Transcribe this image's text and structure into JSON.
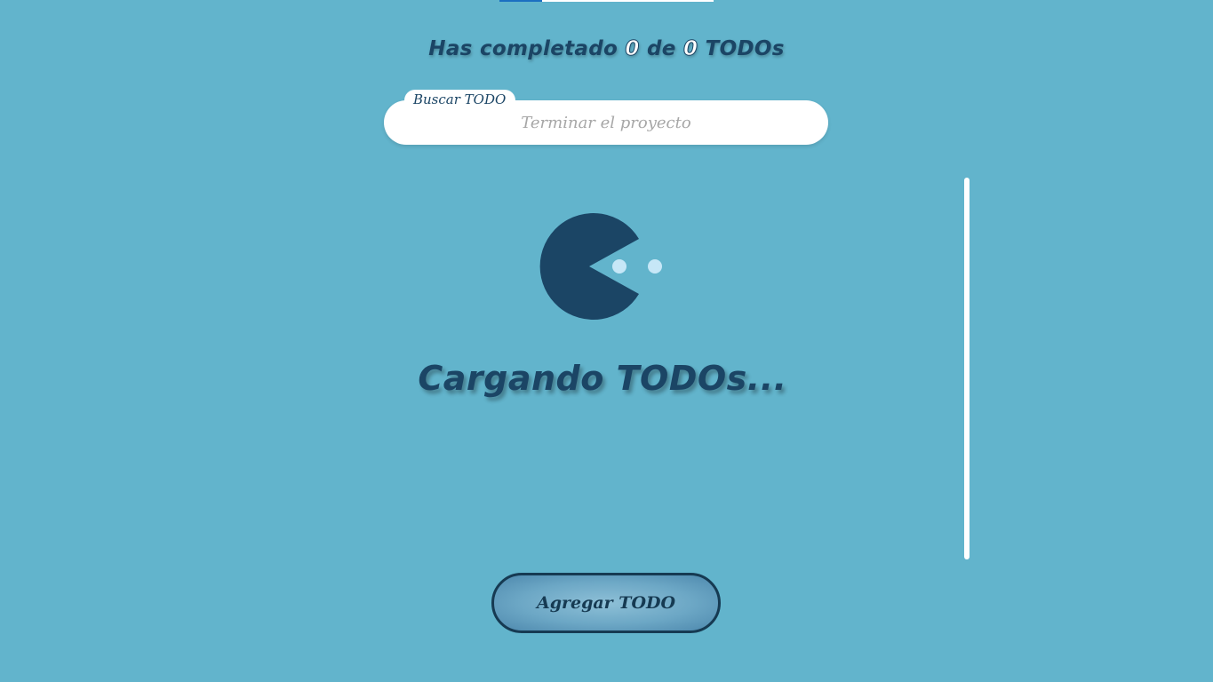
{
  "header": {
    "counter_prefix": "Has completado",
    "completed": "0",
    "counter_middle": "de",
    "total": "0",
    "counter_suffix": "TODOs"
  },
  "progress": {
    "value": 0.2
  },
  "search": {
    "label": "Buscar TODO",
    "placeholder": "Terminar el proyecto",
    "value": ""
  },
  "loading": {
    "text": "Cargando TODOs...",
    "icon": "pacman-loader-icon"
  },
  "add_button": {
    "label": "Agregar TODO"
  },
  "colors": {
    "background": "#62b4cc",
    "primary": "#1b4565",
    "accent": "#c6e7f7",
    "button_border": "#163a52"
  }
}
